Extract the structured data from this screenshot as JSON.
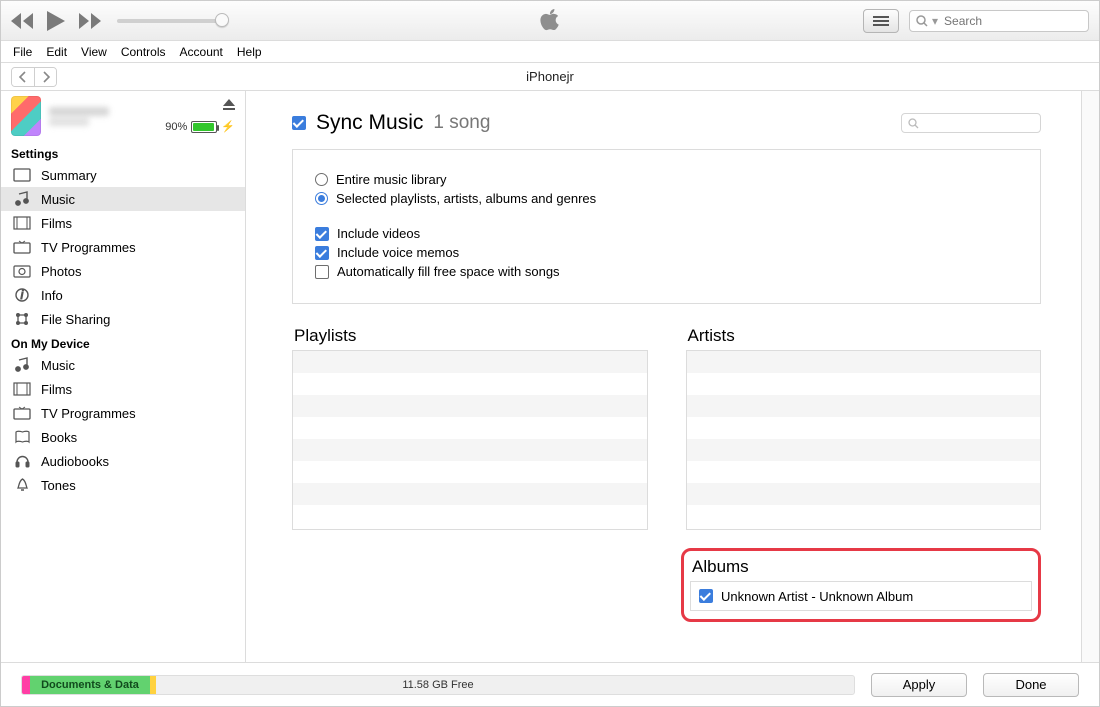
{
  "search_placeholder": "Search",
  "menu": [
    "File",
    "Edit",
    "View",
    "Controls",
    "Account",
    "Help"
  ],
  "nav_title": "iPhonejr",
  "device": {
    "battery_pct": "90%"
  },
  "side_settings_header": "Settings",
  "side_settings": [
    {
      "label": "Summary",
      "icon": "summary"
    },
    {
      "label": "Music",
      "icon": "music"
    },
    {
      "label": "Films",
      "icon": "films"
    },
    {
      "label": "TV Programmes",
      "icon": "tv"
    },
    {
      "label": "Photos",
      "icon": "photos"
    },
    {
      "label": "Info",
      "icon": "info"
    },
    {
      "label": "File Sharing",
      "icon": "fileshare"
    }
  ],
  "side_device_header": "On My Device",
  "side_device": [
    {
      "label": "Music",
      "icon": "music"
    },
    {
      "label": "Films",
      "icon": "films"
    },
    {
      "label": "TV Programmes",
      "icon": "tv"
    },
    {
      "label": "Books",
      "icon": "books"
    },
    {
      "label": "Audiobooks",
      "icon": "audiobooks"
    },
    {
      "label": "Tones",
      "icon": "tones"
    }
  ],
  "sync": {
    "title": "Sync Music",
    "count": "1 song"
  },
  "options": {
    "entire": "Entire music library",
    "selected": "Selected playlists, artists, albums and genres",
    "inc_videos": "Include videos",
    "inc_memos": "Include voice memos",
    "autofill": "Automatically fill free space with songs"
  },
  "lists": {
    "playlists": "Playlists",
    "artists": "Artists",
    "albums": "Albums"
  },
  "album_item": "Unknown Artist - Unknown Album",
  "capacity": {
    "seg_label": "Documents & Data",
    "free": "11.58 GB Free"
  },
  "buttons": {
    "apply": "Apply",
    "done": "Done"
  }
}
